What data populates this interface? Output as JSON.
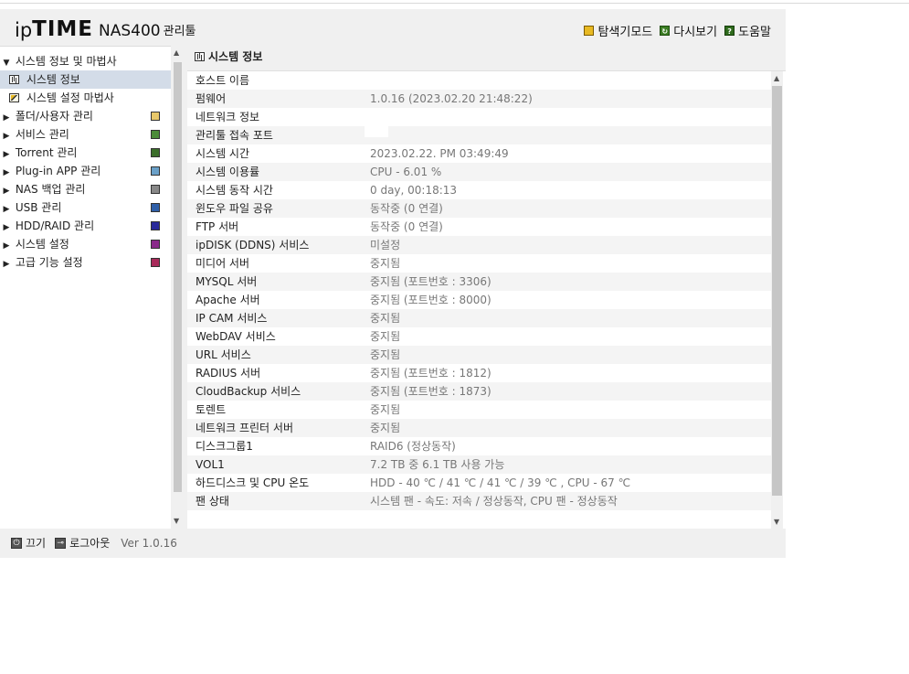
{
  "header": {
    "logo_ip": "ip",
    "logo_time": "TIME",
    "model": "NAS400",
    "suffix": "관리툴",
    "tools": [
      {
        "label": "탐색기모드",
        "icon": "explorer-icon"
      },
      {
        "label": "다시보기",
        "icon": "refresh-icon"
      },
      {
        "label": "도움말",
        "icon": "help-icon"
      }
    ]
  },
  "sidebar": {
    "group_label": "시스템 정보 및 마법사",
    "sub_items": [
      {
        "label": "시스템 정보",
        "icon": "chart-icon",
        "selected": true
      },
      {
        "label": "시스템 설정 마법사",
        "icon": "wizard-icon",
        "selected": false
      }
    ],
    "items": [
      {
        "label": "폴더/사용자 관리",
        "icon": "folder-user-icon"
      },
      {
        "label": "서비스 관리",
        "icon": "service-icon"
      },
      {
        "label": "Torrent 관리",
        "icon": "torrent-icon"
      },
      {
        "label": "Plug-in APP 관리",
        "icon": "plugin-icon"
      },
      {
        "label": "NAS 백업 관리",
        "icon": "backup-icon"
      },
      {
        "label": "USB 관리",
        "icon": "usb-icon"
      },
      {
        "label": "HDD/RAID 관리",
        "icon": "hdd-icon"
      },
      {
        "label": "시스템 설정",
        "icon": "settings-icon"
      },
      {
        "label": "고급 기능 설정",
        "icon": "advanced-icon"
      }
    ]
  },
  "footer": {
    "power_label": "끄기",
    "logout_label": "로그아웃",
    "version": "Ver 1.0.16"
  },
  "panel": {
    "title": "시스템 정보",
    "rows": [
      {
        "key": "호스트 이름",
        "value": ""
      },
      {
        "key": "펌웨어",
        "value": "1.0.16 (2023.02.20 21:48:22)"
      },
      {
        "key": "네트워크 정보",
        "value": ""
      },
      {
        "key": "관리툴 접속 포트",
        "value": ""
      },
      {
        "key": "시스템 시간",
        "value": "2023.02.22. PM 03:49:49"
      },
      {
        "key": "시스템 이용률",
        "value": "CPU - 6.01 %"
      },
      {
        "key": "시스템 동작 시간",
        "value": "0 day, 00:18:13"
      },
      {
        "key": "윈도우 파일 공유",
        "value": "동작중 (0 연결)"
      },
      {
        "key": "FTP 서버",
        "value": "동작중 (0 연결)"
      },
      {
        "key": "ipDISK (DDNS) 서비스",
        "value": "미설정"
      },
      {
        "key": "미디어 서버",
        "value": "중지됨"
      },
      {
        "key": "MYSQL 서버",
        "value": "중지됨 (포트번호 : 3306)"
      },
      {
        "key": "Apache 서버",
        "value": "중지됨 (포트번호 : 8000)"
      },
      {
        "key": "IP CAM 서비스",
        "value": "중지됨"
      },
      {
        "key": "WebDAV 서비스",
        "value": "중지됨"
      },
      {
        "key": "URL 서비스",
        "value": "중지됨"
      },
      {
        "key": "RADIUS 서버",
        "value": "중지됨 (포트번호 : 1812)"
      },
      {
        "key": "CloudBackup 서비스",
        "value": "중지됨 (포트번호 : 1873)"
      },
      {
        "key": "토렌트",
        "value": "중지됨"
      },
      {
        "key": "네트워크 프린터 서버",
        "value": "중지됨"
      },
      {
        "key": "디스크그룹1",
        "value": "RAID6 (정상동작)"
      },
      {
        "key": "VOL1",
        "value": "7.2 TB 중 6.1 TB 사용 가능"
      },
      {
        "key": "하드디스크 및 CPU 온도",
        "value": "HDD - 40 ℃ / 41 ℃ / 41 ℃ / 39 ℃ , CPU - 67 ℃"
      },
      {
        "key": "팬 상태",
        "value": "시스템 팬 - 속도: 저속 / 정상동작,  CPU 팬 - 정상동작"
      }
    ]
  },
  "colors": {
    "app_bg": "#f0f0f0",
    "selected_bg": "#d3dce8",
    "value_text": "#777777"
  }
}
